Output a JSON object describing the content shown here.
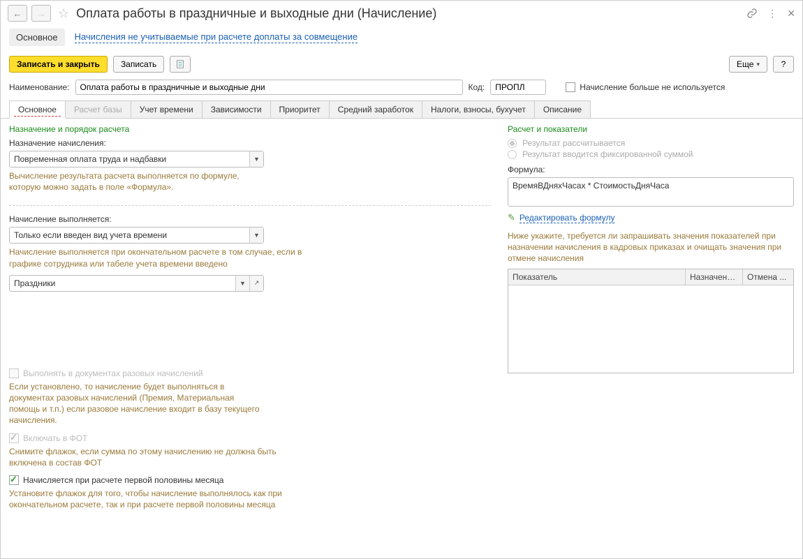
{
  "title": "Оплата работы в праздничные и выходные дни (Начисление)",
  "subnav": {
    "main": "Основное",
    "link": "Начисления не учитываемые при расчете доплаты за совмещение"
  },
  "toolbar": {
    "save_close": "Записать и закрыть",
    "save": "Записать",
    "more": "Еще",
    "help": "?"
  },
  "fields": {
    "name_label": "Наименование:",
    "name_value": "Оплата работы в праздничные и выходные дни",
    "code_label": "Код:",
    "code_value": "ПРОПЛ",
    "not_used_label": "Начисление больше не используется"
  },
  "tabs": {
    "t0": "Основное",
    "t1": "Расчет базы",
    "t2": "Учет времени",
    "t3": "Зависимости",
    "t4": "Приоритет",
    "t5": "Средний заработок",
    "t6": "Налоги, взносы, бухучет",
    "t7": "Описание"
  },
  "left": {
    "section_title": "Назначение и порядок расчета",
    "purpose_label": "Назначение начисления:",
    "purpose_value": "Повременная оплата труда и надбавки",
    "purpose_hint": "Вычисление результата расчета выполняется по формуле, которую можно задать в поле «Формула».",
    "when_label": "Начисление выполняется:",
    "when_value": "Только если введен вид учета времени",
    "when_hint": "Начисление выполняется при окончательном расчете в том случае, если в графике сотрудника или табеле учета времени введено",
    "holidays_value": "Праздники",
    "onetime_label": "Выполнять в документах разовых начислений",
    "onetime_hint": "Если установлено, то начисление будет выполняться в документах разовых начислений (Премия, Материальная помощь и т.п.) если разовое начисление входит в базу текущего начисления.",
    "fot_label": "Включать в ФОТ",
    "fot_hint": "Снимите флажок, если сумма по этому начислению не должна быть включена в состав ФОТ",
    "firsthalf_label": "Начисляется при расчете первой половины месяца",
    "firsthalf_hint": "Установите флажок для того, чтобы начисление выполнялось как при окончательном расчете, так и при расчете первой половины месяца"
  },
  "right": {
    "section_title": "Расчет и показатели",
    "r1": "Результат рассчитывается",
    "r2": "Результат вводится фиксированной суммой",
    "formula_label": "Формула:",
    "formula_value": "ВремяВДняхЧасах * СтоимостьДняЧаса",
    "edit_link": "Редактировать формулу",
    "table_hint": "Ниже укажите, требуется ли запрашивать значения показателей при назначении начисления в кадровых приказах и очищать значения при отмене начисления",
    "col1": "Показатель",
    "col2": "Назначени...",
    "col3": "Отмена ..."
  }
}
